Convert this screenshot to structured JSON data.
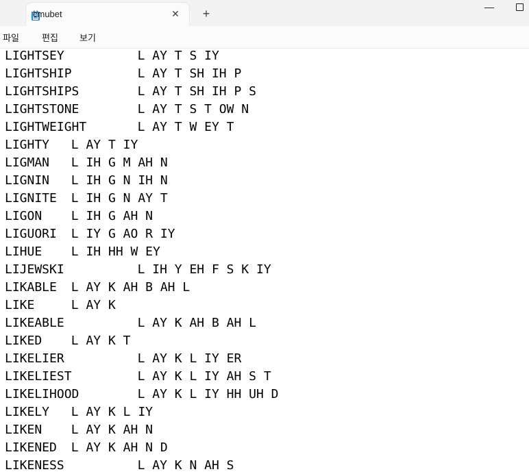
{
  "window": {
    "tab_title": "cmubet",
    "close_glyph": "✕",
    "new_tab_glyph": "+",
    "minimize_glyph": "—"
  },
  "menu": {
    "items": [
      "파일",
      "편집",
      "보기"
    ]
  },
  "editor": {
    "lines": [
      {
        "word": "LIGHTSEY",
        "pron": "L AY T S IY"
      },
      {
        "word": "LIGHTSHIP",
        "pron": "L AY T SH IH P"
      },
      {
        "word": "LIGHTSHIPS",
        "pron": "L AY T SH IH P S"
      },
      {
        "word": "LIGHTSTONE",
        "pron": "L AY T S T OW N"
      },
      {
        "word": "LIGHTWEIGHT",
        "pron": "L AY T W EY T"
      },
      {
        "word": "LIGHTY",
        "pron": "L AY T IY"
      },
      {
        "word": "LIGMAN",
        "pron": "L IH G M AH N"
      },
      {
        "word": "LIGNIN",
        "pron": "L IH G N IH N"
      },
      {
        "word": "LIGNITE",
        "pron": "L IH G N AY T"
      },
      {
        "word": "LIGON",
        "pron": "L IH G AH N"
      },
      {
        "word": "LIGUORI",
        "pron": "L IY G AO R IY"
      },
      {
        "word": "LIHUE",
        "pron": "L IH HH W EY"
      },
      {
        "word": "LIJEWSKI",
        "pron": "L IH Y EH F S K IY"
      },
      {
        "word": "LIKABLE",
        "pron": "L AY K AH B AH L"
      },
      {
        "word": "LIKE",
        "pron": "L AY K"
      },
      {
        "word": "LIKEABLE",
        "pron": "L AY K AH B AH L"
      },
      {
        "word": "LIKED",
        "pron": "L AY K T"
      },
      {
        "word": "LIKELIER",
        "pron": "L AY K L IY ER"
      },
      {
        "word": "LIKELIEST",
        "pron": "L AY K L IY AH S T"
      },
      {
        "word": "LIKELIHOOD",
        "pron": "L AY K L IY HH UH D"
      },
      {
        "word": "LIKELY",
        "pron": "L AY K L IY"
      },
      {
        "word": "LIKEN",
        "pron": "L AY K AH N"
      },
      {
        "word": "LIKENED",
        "pron": "L AY K AH N D"
      },
      {
        "word": "LIKENESS",
        "pron": "L AY K N AH S"
      }
    ]
  }
}
